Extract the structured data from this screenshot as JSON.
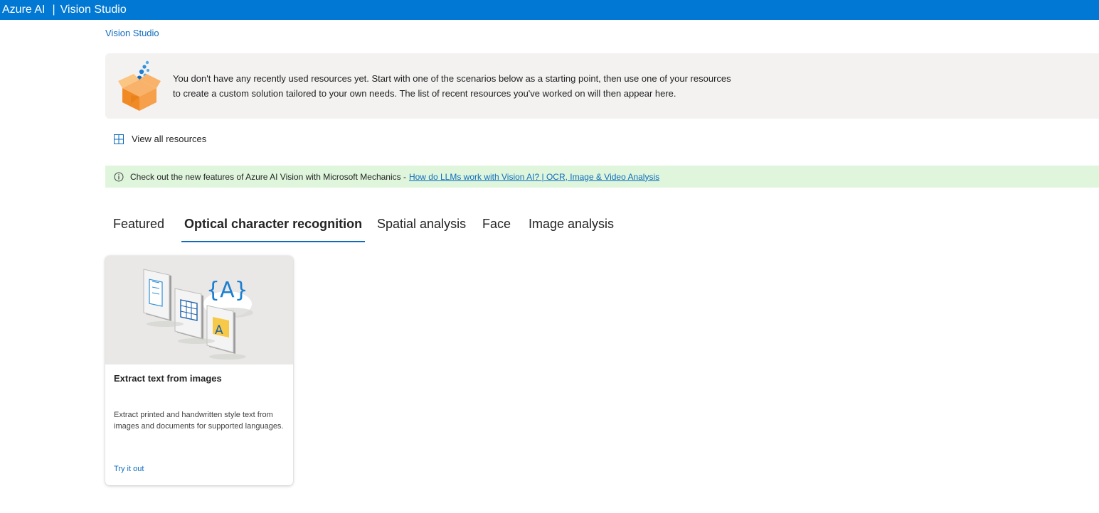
{
  "header": {
    "brand": "Azure AI",
    "separator": "|",
    "product": "Vision Studio"
  },
  "breadcrumb": "Vision Studio",
  "banner": {
    "icon": "open-box-icon",
    "line1": "You don't have any recently used resources yet. Start with one of the scenarios below as a starting point, then use one of your resources",
    "line2": "to create a custom solution tailored to your own needs. The list of recent resources you've worked on will then appear here."
  },
  "view_all": {
    "icon": "grid-icon",
    "label": "View all resources"
  },
  "notice": {
    "icon": "info-icon",
    "text": "Check out the new features of Azure AI Vision with Microsoft Mechanics -",
    "link": "How do LLMs work with Vision AI? | OCR, Image & Video Analysis",
    "color": "#dff6dd"
  },
  "tabs": [
    {
      "label": "Featured",
      "active": false
    },
    {
      "label": "Optical character recognition",
      "active": true
    },
    {
      "label": "Spatial analysis",
      "active": false
    },
    {
      "label": "Face",
      "active": false
    },
    {
      "label": "Image analysis",
      "active": false
    }
  ],
  "cards": [
    {
      "title": "Extract text from images",
      "description": "Extract printed and handwritten style text from images and documents for supported languages.",
      "link": "Try it out",
      "illustration": "ocr-documents-illustration"
    }
  ],
  "colors": {
    "accent": "#0078d4",
    "link": "#0f6cbd",
    "banner_bg": "#f3f2f1"
  }
}
